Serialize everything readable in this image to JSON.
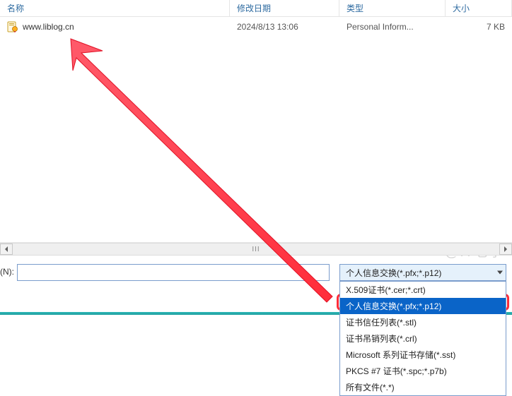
{
  "columns": {
    "name": "名称",
    "date": "修改日期",
    "type": "类型",
    "size": "大小"
  },
  "file": {
    "name": "www.liblog.cn",
    "date": "2024/8/13 13:06",
    "type": "Personal Inform...",
    "size": "7 KB"
  },
  "bottom": {
    "label": "(N):",
    "filename_value": "",
    "combo_selected": "个人信息交换(*.pfx;*.p12)"
  },
  "dropdown": {
    "items": [
      "X.509证书(*.cer;*.crt)",
      "个人信息交换(*.pfx;*.p12)",
      "证书信任列表(*.stl)",
      "证书吊销列表(*.crl)",
      "Microsoft 系列证书存储(*.sst)",
      "PKCS #7 证书(*.spc;*.p7b)",
      "所有文件(*.*)"
    ],
    "highlight_index": 1
  },
  "watermark": "@IT老李",
  "cursor_marks": "⌐¬"
}
